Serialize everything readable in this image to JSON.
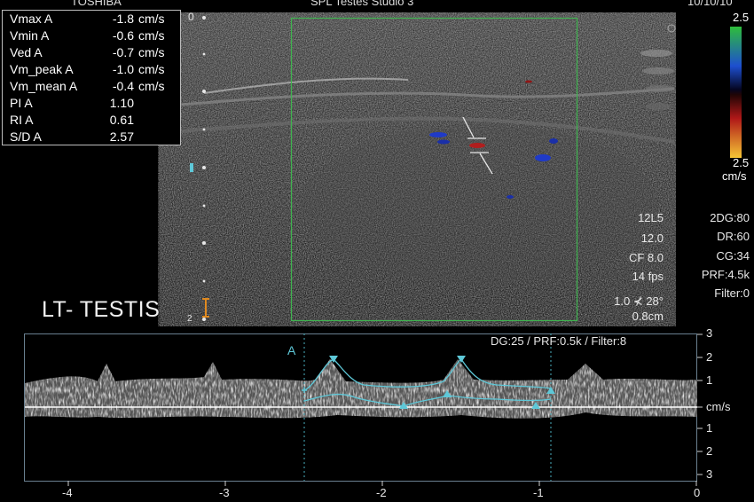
{
  "header": {
    "left": "TOSHIBA",
    "center": "SPL    Testes Studio 3",
    "right": "10/10/10"
  },
  "measurements": [
    {
      "label": "Vmax  A",
      "value": "-1.8",
      "unit": "cm/s"
    },
    {
      "label": "Vmin  A",
      "value": "-0.6",
      "unit": "cm/s"
    },
    {
      "label": "Ved  A",
      "value": "-0.7",
      "unit": "cm/s"
    },
    {
      "label": "Vm_peak  A",
      "value": "-1.0",
      "unit": "cm/s"
    },
    {
      "label": "Vm_mean  A",
      "value": "-0.4",
      "unit": "cm/s"
    },
    {
      "label": "PI  A",
      "value": "1.10",
      "unit": ""
    },
    {
      "label": "RI  A",
      "value": "0.61",
      "unit": ""
    },
    {
      "label": "S/D  A",
      "value": "2.57",
      "unit": ""
    }
  ],
  "depth_zero": "0",
  "depth_marker_two": "2",
  "label_text": "LT- TESTIS",
  "color_bar": {
    "top": "2.5",
    "bottom": "2.5",
    "unit": "cm/s",
    "colors": [
      "#2ebd3a",
      "#1d2fb0",
      "#000000",
      "#a01010",
      "#f0c030"
    ]
  },
  "params_left": [
    "12L5",
    "12.0",
    "CF 8.0",
    "14 fps",
    "1.0 ⊀ 28°",
    "0.8cm"
  ],
  "params_right": [
    "2DG:80",
    "DR:60",
    "CG:34",
    "PRF:4.5k",
    "Filter:0"
  ],
  "doppler_info": "DG:25 /   PRF:0.5k   / Filter:8",
  "cursor_label": "A",
  "velocity_scale": [
    "3",
    "2",
    "1",
    "cm/s",
    "1",
    "2",
    "3"
  ],
  "time_axis": [
    "-4",
    "-3",
    "-2",
    "-1",
    "0"
  ],
  "accent_color": "#5ec8d8",
  "roi_color": "#3fb34f"
}
